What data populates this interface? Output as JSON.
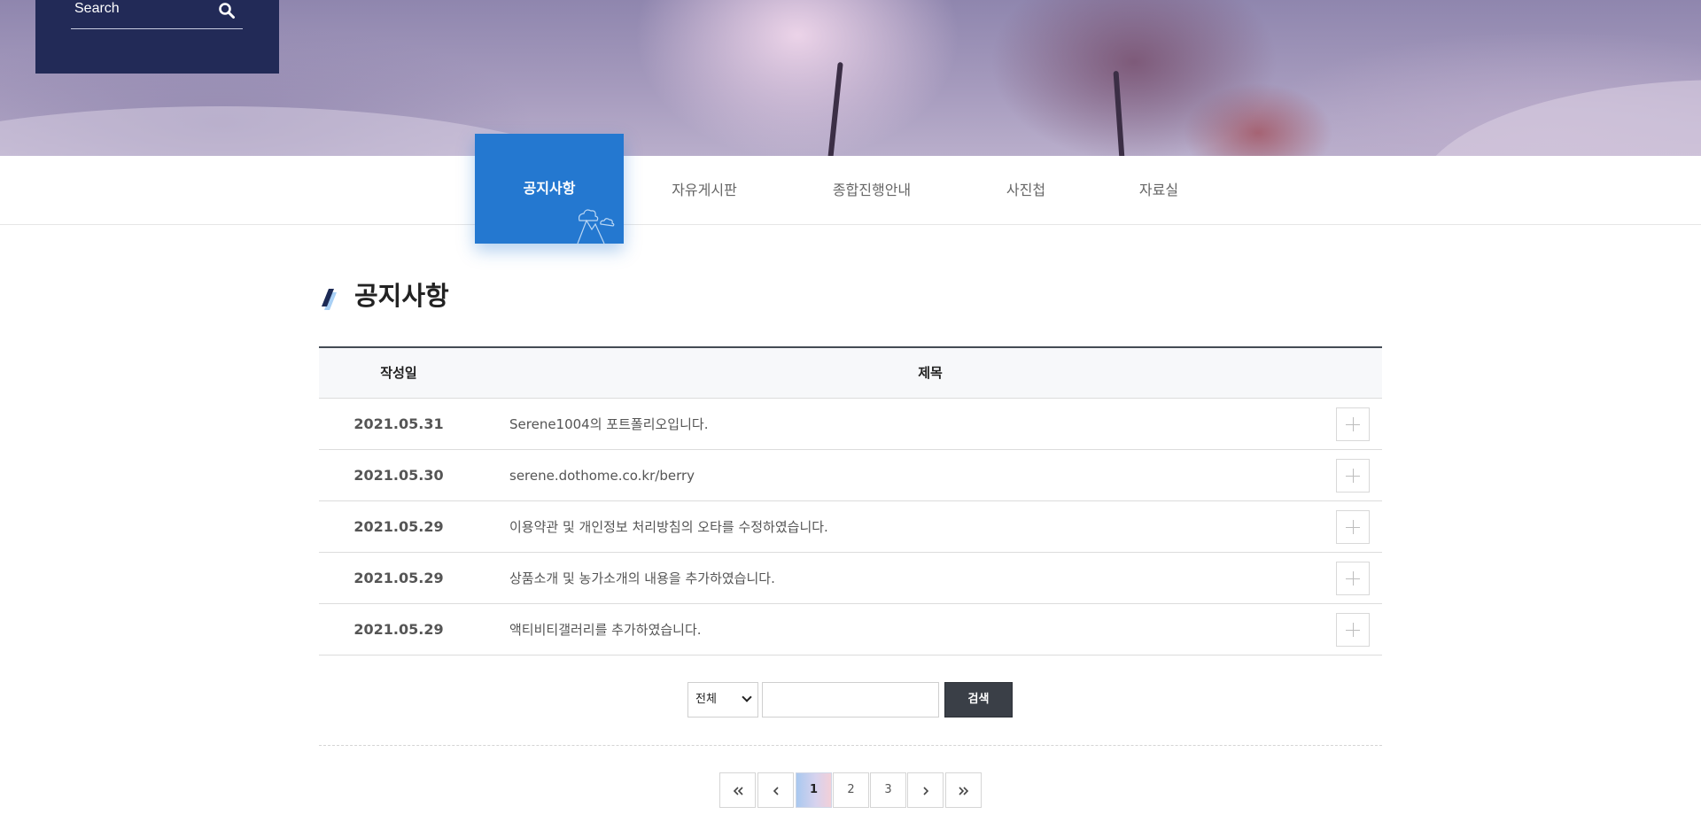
{
  "header": {
    "search_placeholder": "Search"
  },
  "subnav": {
    "items": [
      {
        "label": "공지사항",
        "active": true
      },
      {
        "label": "자유게시판",
        "active": false
      },
      {
        "label": "종합진행안내",
        "active": false
      },
      {
        "label": "사진첩",
        "active": false
      },
      {
        "label": "자료실",
        "active": false
      }
    ]
  },
  "page": {
    "title": "공지사항"
  },
  "board": {
    "columns": [
      "작성일",
      "제목"
    ],
    "rows": [
      {
        "date": "2021.05.31",
        "title": "Serene1004의 포트폴리오입니다."
      },
      {
        "date": "2021.05.30",
        "title": "serene.dothome.co.kr/berry"
      },
      {
        "date": "2021.05.29",
        "title": "이용약관 및 개인정보 처리방침의 오타를 수정하였습니다."
      },
      {
        "date": "2021.05.29",
        "title": "상품소개 및 농가소개의 내용을 추가하였습니다."
      },
      {
        "date": "2021.05.29",
        "title": "액티비티갤러리를 추가하였습니다."
      }
    ]
  },
  "search_form": {
    "select_value": "전체",
    "input_value": "",
    "button_label": "검색"
  },
  "pagination": {
    "pages": [
      "1",
      "2",
      "3"
    ],
    "current": "1"
  },
  "colors": {
    "accent": "#2478d0",
    "search_panel_bg": "#222a57",
    "search_button_bg": "#3a3f47"
  }
}
